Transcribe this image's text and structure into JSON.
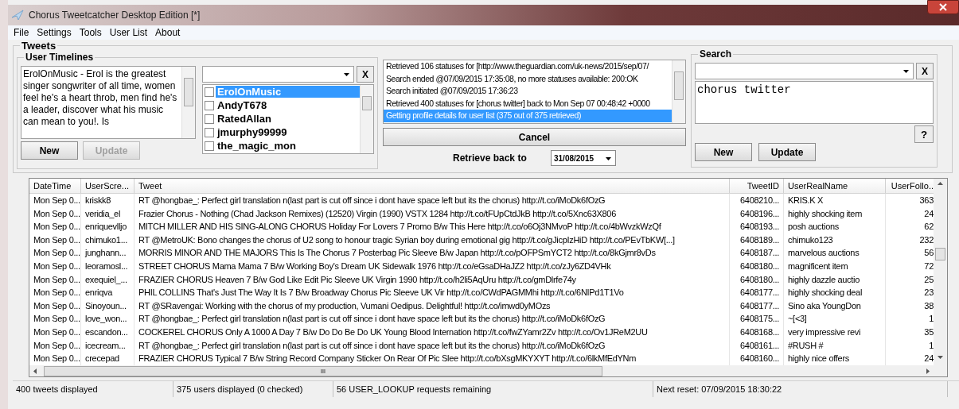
{
  "window": {
    "title": "Chorus Tweetcatcher Desktop Edition [*]"
  },
  "menu": [
    "File",
    "Settings",
    "Tools",
    "User List",
    "About"
  ],
  "tweets_group": {
    "title": "Tweets",
    "user_timelines": {
      "title": "User Timelines",
      "description": "ErolOnMusic - Erol is the greatest singer songwriter of all time, women feel he's a heart throb, men find he's a leader, discover what his music can mean to you!. Is",
      "clear_button": "X",
      "users": [
        {
          "name": "ErolOnMusic",
          "checked": false,
          "selected": true
        },
        {
          "name": "AndyT678",
          "checked": false,
          "selected": false
        },
        {
          "name": "RatedAllan",
          "checked": false,
          "selected": false
        },
        {
          "name": "jmurphy99999",
          "checked": false,
          "selected": false
        },
        {
          "name": "the_magic_mon",
          "checked": false,
          "selected": false
        }
      ],
      "buttons": [
        {
          "label": "New",
          "disabled": false
        },
        {
          "label": "Update",
          "disabled": true
        }
      ]
    },
    "log": [
      {
        "text": "Retrieved 106 statuses for [http://www.theguardian.com/uk-news/2015/sep/07/",
        "selected": false
      },
      {
        "text": "Search ended @07/09/2015 17:35:08, no more statuses available: 200:OK",
        "selected": false
      },
      {
        "text": "Search initiated @07/09/2015 17:36:23",
        "selected": false
      },
      {
        "text": "Retrieved 400 statuses for [chorus twitter] back to Mon Sep 07 00:48:42 +0000",
        "selected": false
      },
      {
        "text": "Getting profile details for user list (375 out of 375 retrieved)",
        "selected": true
      }
    ],
    "cancel_button": "Cancel",
    "retrieve_label": "Retrieve back to",
    "retrieve_date": "31/08/2015",
    "search": {
      "title": "Search",
      "clear_button": "X",
      "query": "chorus twitter",
      "help_button": "?",
      "buttons": [
        {
          "label": "New",
          "disabled": false
        },
        {
          "label": "Update",
          "disabled": false
        }
      ]
    }
  },
  "table": {
    "columns": [
      "DateTime",
      "UserScre...",
      "Tweet",
      "TweetID",
      "UserRealName",
      "UserFollo.."
    ],
    "rows": [
      [
        "Mon Sep 0...",
        "kriskk8",
        "RT @hongbae_: Perfect girl translation n(last part is cut off since i dont have space left but its the chorus) http://t.co/iMoDk6fOzG",
        "6408210...",
        "KRIS.K X",
        "363"
      ],
      [
        "Mon Sep 0...",
        "veridia_el",
        "Frazier Chorus - Nothing (Chad Jackson Remixes) (12520) Virgin (1990) VSTX 1284 http://t.co/tFUpCtdJkB http://t.co/5Xnc63X806",
        "6408196...",
        "highly shocking item",
        "24"
      ],
      [
        "Mon Sep 0...",
        "enriquevlljo",
        "MITCH MILLER AND HIS SING-ALONG CHORUS Holiday For Lovers 7 Promo B/w This Here http://t.co/o6Oj3NMvoP http://t.co/4bWvzkWzQf",
        "6408193...",
        "posh auctions",
        "62"
      ],
      [
        "Mon Sep 0...",
        "chimuko1...",
        "RT @MetroUK: Bono changes the chorus of U2 song to honour tragic Syrian boy during emotional gig http://t.co/gJicpIzHiD http://t.co/PEvTbKW[...]",
        "6408189...",
        "chimuko123",
        "232"
      ],
      [
        "Mon Sep 0...",
        "junghann...",
        "MORRIS MINOR AND THE MAJORS This Is The Chorus 7 Posterbag Pic Sleeve B/w Japan http://t.co/pOFPSmYCT2 http://t.co/8kGjmr8vDs",
        "6408187...",
        "marvelous auctions",
        "56"
      ],
      [
        "Mon Sep 0...",
        "leoramosl...",
        "STREET CHORUS Mama Mama 7 B/w Working Boy's Dream  UK Sidewalk 1976 http://t.co/eGsaDHaJZ2 http://t.co/zJy6ZD4VHk",
        "6408180...",
        "magnificent item",
        "72"
      ],
      [
        "Mon Sep 0...",
        "exequiel_...",
        "FRAZIER CHORUS Heaven 7 B/w God Like Edit  Pic Sleeve UK Virgin 1990 http://t.co/h2li5AqUru http://t.co/gmDlrfe74y",
        "6408180...",
        "highly dazzle auctio",
        "25"
      ],
      [
        "Mon Sep 0...",
        "enriqva",
        "PHIL COLLINS That's Just The Way It Is 7 B/w Broadway Chorus  Pic Sleeve UK Vir http://t.co/CWdPAGMMhi http://t.co/6NIPd1T1Vo",
        "6408177...",
        "highly shocking deal",
        "23"
      ],
      [
        "Mon Sep 0...",
        "Sinoyoun...",
        "RT @SRavengai: Working with the chorus of my production, Vumani Oedipus. Delightful! http://t.co/imwd0yMOzs",
        "6408177...",
        "Sino aka YoungDon",
        "38"
      ],
      [
        "Mon Sep 0...",
        "love_won...",
        "RT @hongbae_: Perfect girl translation n(last part is cut off since i dont have space left but its the chorus) http://t.co/iMoDk6fOzG",
        "6408175...",
        "~[<3]",
        "1"
      ],
      [
        "Mon Sep 0...",
        "escandon...",
        "COCKEREL CHORUS Only A 1000 A Day 7 B/w Do Do Be Do  UK Young Blood Internation http://t.co/fwZYamr2Zv http://t.co/Ov1JReM2UU",
        "6408168...",
        "very impressive revi",
        "35"
      ],
      [
        "Mon Sep 0...",
        "icecream...",
        "RT @hongbae_: Perfect girl translation n(last part is cut off since i dont have space left but its the chorus) http://t.co/iMoDk6fOzG",
        "6408161...",
        "#RUSH #",
        "1"
      ],
      [
        "Mon Sep 0...",
        "crecepad",
        "FRAZIER CHORUS Typical 7 B/w String  Record Company Sticker On Rear Of Pic Slee http://t.co/bXsgMKYXYT http://t.co/6lkMfEdYNm",
        "6408160...",
        "highly nice offers",
        "24"
      ]
    ],
    "hscroll_grip": "III"
  },
  "status_bar": [
    "400 tweets displayed",
    "375 users displayed (0 checked)",
    "56 USER_LOOKUP requests remaining",
    "Next reset: 07/09/2015 18:30:22"
  ]
}
